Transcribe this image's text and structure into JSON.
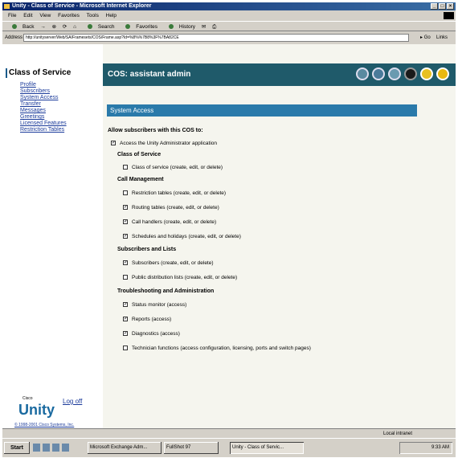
{
  "browser": {
    "title": "Unity - Class of Service - Microsoft Internet Explorer",
    "menu": [
      "File",
      "Edit",
      "View",
      "Favorites",
      "Tools",
      "Help"
    ],
    "toolbar": {
      "back": "Back",
      "search": "Search",
      "favorites": "Favorites",
      "history": "History"
    },
    "address_label": "Address",
    "address_value": "http://unityserver/Web/SA/Framesets/COS/Frame.asp?Id=%8%%7B8%3F%7BA82CE",
    "go_label": "Go",
    "links_label": "Links",
    "status_zone": "Local intranet"
  },
  "sidebar": {
    "title": "Class of Service",
    "links": [
      "Profile",
      "Subscribers",
      "System Access",
      "Transfer",
      "Messages",
      "Greetings",
      "Licensed Features",
      "Restriction Tables"
    ],
    "brand_small": "Cisco",
    "brand": "Unity",
    "logoff": "Log off",
    "copyright": "© 1998-2001 Cisco Systems, Inc."
  },
  "header": {
    "title": "COS: assistant admin"
  },
  "section": {
    "title": "System Access"
  },
  "form": {
    "intro": "Allow subscribers with this COS to:",
    "top": {
      "label": "Access the Unity Administrator application",
      "checked": true
    },
    "groups": [
      {
        "title": "Class of Service",
        "items": [
          {
            "label": "Class of service (create, edit, or delete)",
            "checked": false
          }
        ]
      },
      {
        "title": "Call Management",
        "items": [
          {
            "label": "Restriction tables (create, edit, or delete)",
            "checked": false
          },
          {
            "label": "Routing tables (create, edit, or delete)",
            "checked": true
          },
          {
            "label": "Call handlers (create, edit, or delete)",
            "checked": true
          },
          {
            "label": "Schedules and holidays (create, edit, or delete)",
            "checked": true
          }
        ]
      },
      {
        "title": "Subscribers and Lists",
        "items": [
          {
            "label": "Subscribers (create, edit, or delete)",
            "checked": true
          },
          {
            "label": "Public distribution lists (create, edit, or delete)",
            "checked": false
          }
        ]
      },
      {
        "title": "Troubleshooting and Administration",
        "items": [
          {
            "label": "Status monitor (access)",
            "checked": true
          },
          {
            "label": "Reports (access)",
            "checked": true
          },
          {
            "label": "Diagnostics (access)",
            "checked": true
          },
          {
            "label": "Technician functions (access configuration, licensing, ports and switch pages)",
            "checked": false
          }
        ]
      }
    ]
  },
  "taskbar": {
    "start": "Start",
    "tasks": [
      "Microsoft Exchange Adm...",
      "FullShot 97",
      "Unity - Class of Servic..."
    ],
    "clock": "9:33 AM"
  },
  "colors": {
    "header_bg": "#1f5a6a",
    "section_bg": "#2a7aaa",
    "link": "#1a3a9a",
    "title_bar": "#0a246a"
  }
}
